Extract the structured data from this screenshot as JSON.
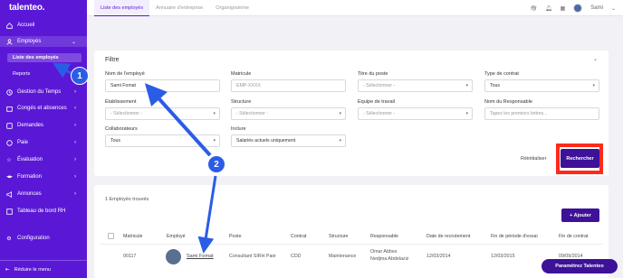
{
  "app": {
    "logo": "talenteo."
  },
  "sidebar": {
    "items": [
      {
        "label": "Accueil",
        "icon": "home-icon"
      },
      {
        "label": "Employés",
        "icon": "users-icon"
      },
      {
        "label": "Gestion du Temps",
        "icon": "clock-icon"
      },
      {
        "label": "Congés et absences",
        "icon": "calendar-icon"
      },
      {
        "label": "Demandes",
        "icon": "inbox-icon"
      },
      {
        "label": "Paie",
        "icon": "money-icon"
      },
      {
        "label": "Évaluation",
        "icon": "star-icon"
      },
      {
        "label": "Formation",
        "icon": "graduation-icon"
      },
      {
        "label": "Annonces",
        "icon": "megaphone-icon"
      },
      {
        "label": "Tableau de bord RH",
        "icon": "dashboard-icon"
      },
      {
        "label": "Configuration",
        "icon": "gear-icon"
      }
    ],
    "sub_items": [
      "Liste des employés",
      "Reports"
    ],
    "collapse_label": "Réduire le menu"
  },
  "topbar": {
    "tabs": [
      "Liste des employés",
      "Annuaire d'entreprise",
      "Organigramme"
    ],
    "user_name": "Sami"
  },
  "filter": {
    "title": "Filtre",
    "fields": {
      "nom": {
        "label": "Nom de l'employé",
        "value": "Sami Fomat"
      },
      "matricule": {
        "label": "Matricule",
        "placeholder": "EMP-XXXX"
      },
      "titre": {
        "label": "Titre du poste",
        "value": "- Sélectionner -"
      },
      "contrat": {
        "label": "Type de contrat",
        "value": "Tous"
      },
      "etablissement": {
        "label": "Établissement",
        "value": "- Sélectionner -"
      },
      "structure": {
        "label": "Structure",
        "value": "- Sélectionner -"
      },
      "equipe": {
        "label": "Equipe de travail",
        "value": "- Sélectionner -"
      },
      "responsable": {
        "label": "Nom du Responsable",
        "placeholder": "Tapez les premiers lettres..."
      },
      "collaborateurs": {
        "label": "Collaborateurs",
        "value": "Tous"
      },
      "inclure": {
        "label": "Inclure",
        "value": "Salariés actuels uniquement"
      }
    },
    "reset_label": "Réinitialiser",
    "search_label": "Rechercher"
  },
  "results": {
    "count_text": "1 Employés trouvés",
    "add_label": "+ Ajouter",
    "columns": [
      "Matricule",
      "Employé",
      "Poste",
      "Contrat",
      "Structure",
      "Responsable",
      "Date de recrutement",
      "Fin de période d'essai",
      "Fin de contrat"
    ],
    "rows": [
      {
        "matricule": "00117",
        "employe": "Sami Fomat",
        "poste": "Consultant SIRH Paie",
        "contrat": "CDD",
        "structure": "Maintenance",
        "responsable_1": "Omar Abbes",
        "responsable_2": "Nedjma Abdelaziz",
        "recrutement": "12/03/2014",
        "essai": "12/03/2015",
        "fin_contrat": "09/09/2014"
      }
    ]
  },
  "help_label": "Paramétrez Talenteo",
  "annotations": [
    "1",
    "2"
  ],
  "colors": {
    "brand": "#5a18d6",
    "button": "#3d1298",
    "highlight": "#ff2a1a",
    "callout": "#2b5ce6"
  }
}
